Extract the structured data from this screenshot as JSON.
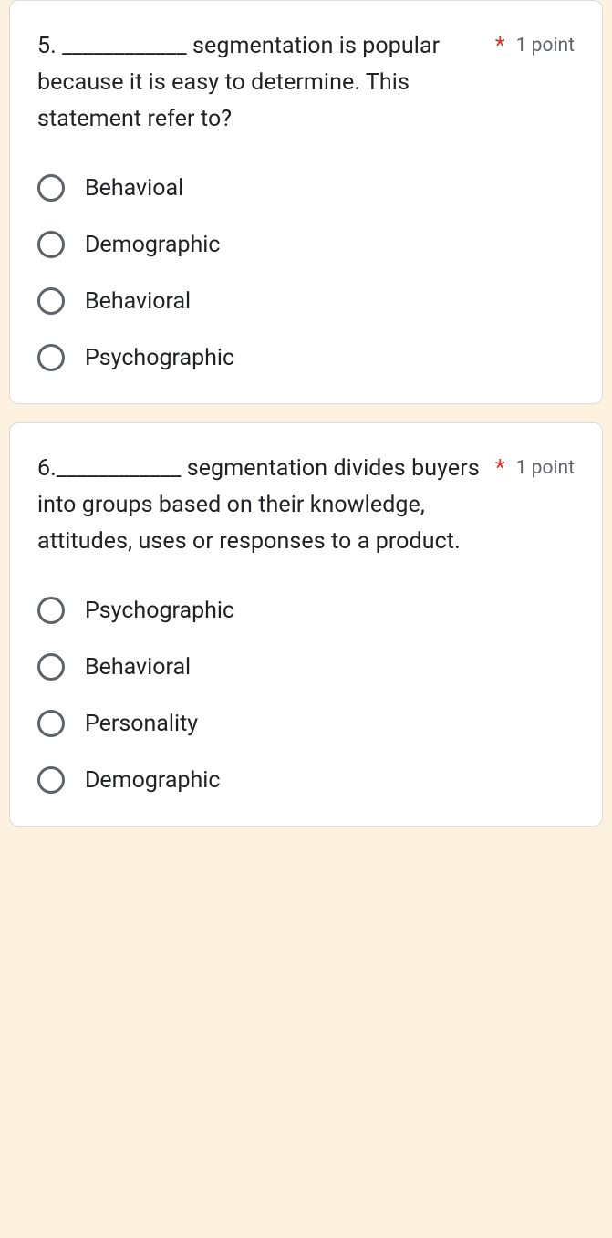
{
  "questions": [
    {
      "text": "5. ____________ segmentation is popular because it is easy to determine. This statement refer to?",
      "required_mark": "*",
      "points": "1 point",
      "options": [
        {
          "label": "Behavioal"
        },
        {
          "label": "Demographic"
        },
        {
          "label": "Behavioral"
        },
        {
          "label": "Psychographic"
        }
      ]
    },
    {
      "text": "6.____________ segmentation divides buyers into groups based on their knowledge, attitudes, uses or responses to a product.",
      "required_mark": "*",
      "points": "1 point",
      "options": [
        {
          "label": "Psychographic"
        },
        {
          "label": "Behavioral"
        },
        {
          "label": "Personality"
        },
        {
          "label": "Demographic"
        }
      ]
    }
  ]
}
